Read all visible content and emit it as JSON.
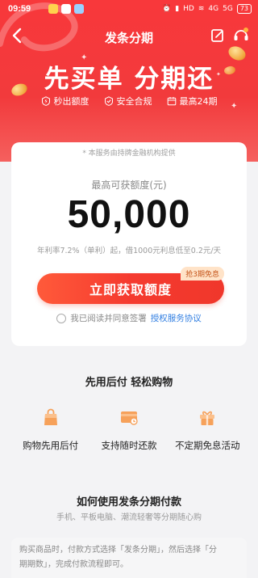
{
  "status_bar": {
    "time": "09:59",
    "network": "HD",
    "signal_1": "4G",
    "signal_2": "5G",
    "battery": "73"
  },
  "nav": {
    "title": "发条分期"
  },
  "hero": {
    "slogan": "先买单 分期还",
    "features": [
      {
        "icon": "lightning-badge-icon",
        "label": "秒出额度"
      },
      {
        "icon": "shield-check-icon",
        "label": "安全合规"
      },
      {
        "icon": "calendar-icon",
        "label": "最高24期"
      }
    ]
  },
  "card": {
    "notice": "* 本服务由持牌金融机构提供",
    "limit_label": "最高可获额度(元)",
    "amount": "50,000",
    "rate_text": "年利率7.2%（单利）起，借1000元利息低至0.2元/天",
    "cta_label": "立即获取额度",
    "cta_badge": "抢3期免息",
    "agree_text": "我已阅读并同意签署",
    "agree_link": "授权服务协议"
  },
  "benefits": {
    "title": "先用后付 轻松购物",
    "items": [
      {
        "icon": "shopping-bag-icon",
        "label": "购物先用后付"
      },
      {
        "icon": "repay-card-icon",
        "label": "支持随时还款"
      },
      {
        "icon": "gift-icon",
        "label": "不定期免息活动"
      }
    ]
  },
  "howto": {
    "title": "如何使用发条分期付款",
    "subtitle": "手机、平板电脑、潮流轻奢等分期随心购",
    "line1": "购买商品时，付款方式选择「发条分期」，然后选择「分",
    "line2": "期期数」，完成付款流程即可。"
  },
  "colors": {
    "brand_red": "#f23a3c",
    "cta_red": "#f53a2f",
    "link_blue": "#2f7de1",
    "icon_orange": "#f5a35c"
  }
}
